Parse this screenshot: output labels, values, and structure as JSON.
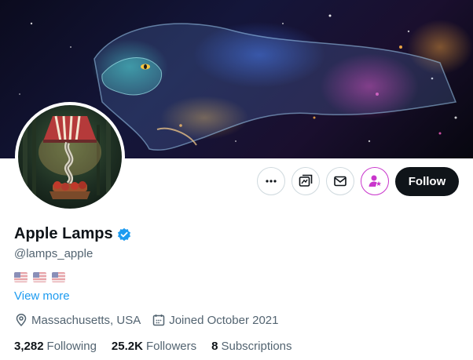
{
  "profile": {
    "display_name": "Apple Lamps",
    "handle": "@lamps_apple",
    "verified": true,
    "flags": [
      "us-flag",
      "us-flag",
      "us-flag"
    ],
    "view_more": "View more",
    "location": "Massachusetts, USA",
    "joined": "Joined October 2021"
  },
  "stats": {
    "following_count": "3,282",
    "following_label": "Following",
    "followers_count": "25.2K",
    "followers_label": "Followers",
    "subscriptions_count": "8",
    "subscriptions_label": "Subscriptions"
  },
  "actions": {
    "follow_label": "Follow",
    "icons": [
      "more-icon",
      "grok-icon",
      "message-icon",
      "subscribe-icon"
    ]
  },
  "colors": {
    "accent": "#1d9bf0",
    "follow_bg": "#0f1419",
    "subscribe": "#c936cc",
    "muted_text": "#536471"
  }
}
